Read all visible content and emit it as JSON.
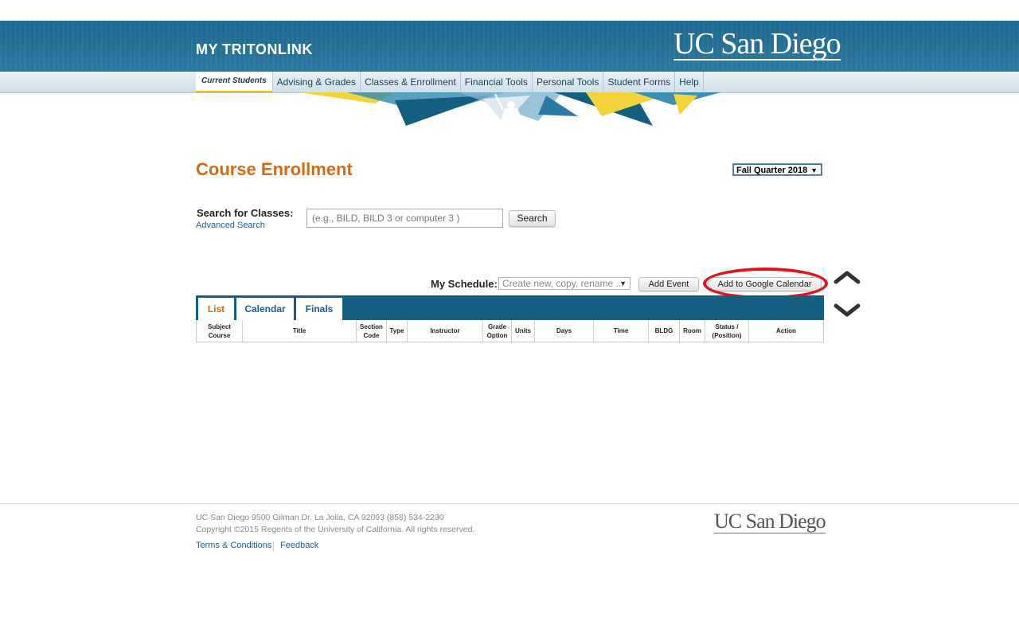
{
  "header": {
    "brand": "MY TRITONLINK",
    "logo": "UC San Diego"
  },
  "nav": {
    "items": [
      {
        "label": "Current Students"
      },
      {
        "label": "Advising & Grades"
      },
      {
        "label": "Classes & Enrollment"
      },
      {
        "label": "Financial Tools"
      },
      {
        "label": "Personal Tools"
      },
      {
        "label": "Student Forms"
      },
      {
        "label": "Help"
      }
    ]
  },
  "main": {
    "title": "Course Enrollment",
    "term_selected": "Fall Quarter 2018",
    "search": {
      "label": "Search for Classes:",
      "advanced_link": "Advanced Search",
      "placeholder": "(e.g., BILD, BILD 3 or computer 3 )",
      "button": "Search"
    },
    "schedule": {
      "label": "My Schedule:",
      "select_placeholder": "Create new, copy, rename ...",
      "add_event": "Add Event",
      "add_google": "Add to Google Calendar"
    },
    "tabs": [
      {
        "label": "List"
      },
      {
        "label": "Calendar"
      },
      {
        "label": "Finals"
      }
    ],
    "table_headers": [
      {
        "line1": "Subject",
        "line2": "Course"
      },
      {
        "line1": "Title",
        "line2": ""
      },
      {
        "line1": "Section",
        "line2": "Code"
      },
      {
        "line1": "Type",
        "line2": ""
      },
      {
        "line1": "Instructor",
        "line2": ""
      },
      {
        "line1": "Grade",
        "line2": "Option"
      },
      {
        "line1": "Units",
        "line2": ""
      },
      {
        "line1": "Days",
        "line2": ""
      },
      {
        "line1": "Time",
        "line2": ""
      },
      {
        "line1": "BLDG",
        "line2": ""
      },
      {
        "line1": "Room",
        "line2": ""
      },
      {
        "line1": "Status /",
        "line2": "(Position)"
      },
      {
        "line1": "Action",
        "line2": ""
      }
    ]
  },
  "footer": {
    "address": "UC San Diego 9500 Gilman Dr. La Jolla, CA 92093 (858) 534-2230",
    "copyright": "Copyright ©2015 Regents of the University of California. All rights reserved.",
    "links": [
      {
        "label": "Terms & Conditions"
      },
      {
        "label": "Feedback"
      }
    ],
    "logo": "UC San Diego"
  },
  "colors": {
    "header_blue": "#1b6a91",
    "title_orange": "#d16b15",
    "tab_bar": "#145e80",
    "highlight_red": "#e0141b",
    "banner_yellow": "#f2d33b"
  },
  "icons": {
    "scroll_up": "chevron-up-icon",
    "scroll_down": "chevron-down-icon",
    "select_arrow": "triangle-down-icon"
  }
}
